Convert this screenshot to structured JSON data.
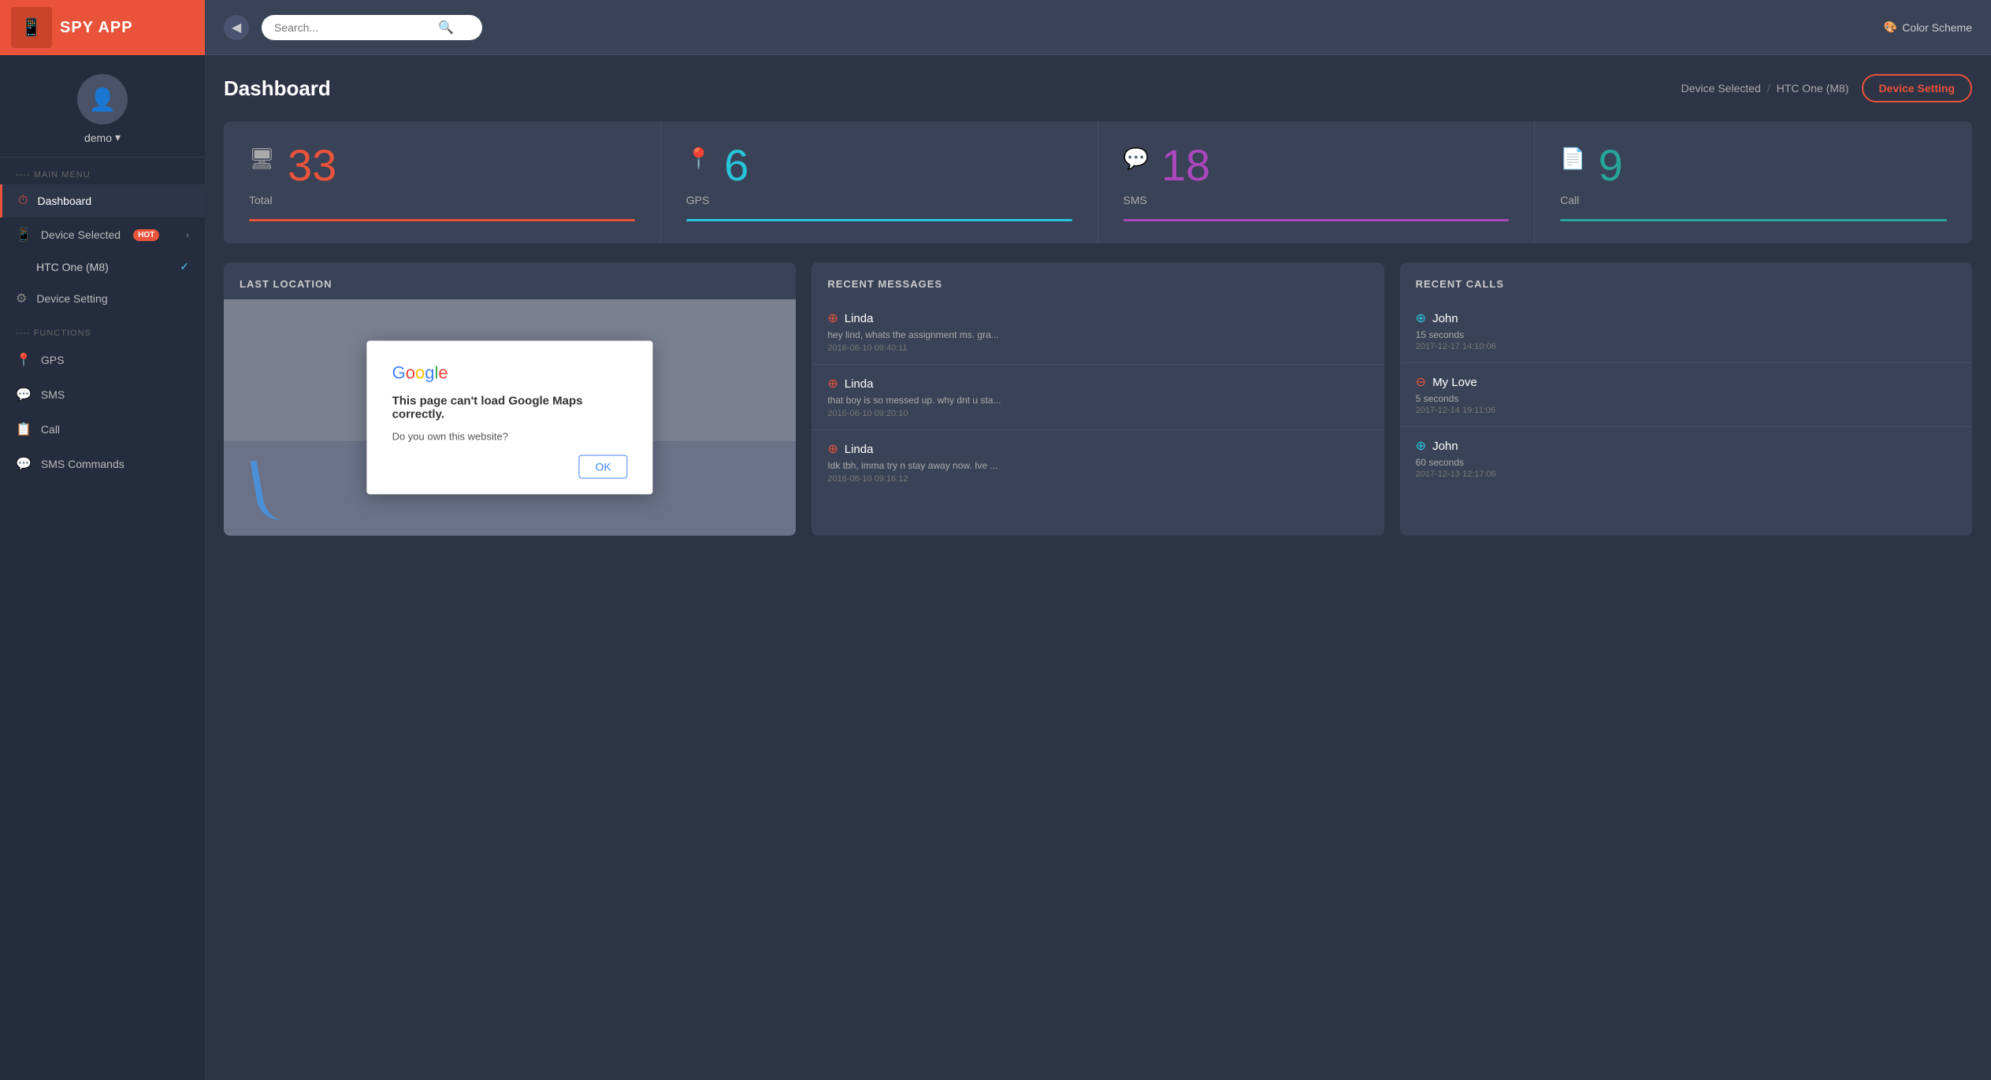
{
  "app": {
    "name": "SPY APP"
  },
  "sidebar": {
    "profile": {
      "username": "demo",
      "dropdown_indicator": "▾"
    },
    "main_menu_label": "---- MAIN MENU",
    "items": [
      {
        "id": "dashboard",
        "label": "Dashboard",
        "icon": "⏱",
        "active": true
      },
      {
        "id": "device-selected",
        "label": "Device Selected",
        "icon": "📱",
        "badge": "HOT",
        "chevron": "›",
        "active": false
      },
      {
        "id": "htc-one",
        "label": "HTC One (M8)",
        "sub": true,
        "check": "✓"
      },
      {
        "id": "device-setting",
        "label": "Device Setting",
        "icon": "⚙",
        "active": false
      }
    ],
    "functions_label": "---- FUNCTIONS",
    "function_items": [
      {
        "id": "gps",
        "label": "GPS",
        "icon": "📍"
      },
      {
        "id": "sms",
        "label": "SMS",
        "icon": "💬"
      },
      {
        "id": "call",
        "label": "Call",
        "icon": "📋"
      },
      {
        "id": "sms-commands",
        "label": "SMS Commands",
        "icon": "💬"
      }
    ]
  },
  "topbar": {
    "search_placeholder": "Search...",
    "color_scheme_label": "Color Scheme"
  },
  "header": {
    "title": "Dashboard",
    "breadcrumb_device_selected": "Device Selected",
    "breadcrumb_separator": "/",
    "breadcrumb_device": "HTC One (M8)",
    "device_setting_btn": "Device Setting"
  },
  "stats": [
    {
      "id": "total",
      "label": "Total",
      "value": "33",
      "color": "orange"
    },
    {
      "id": "gps",
      "label": "GPS",
      "value": "6",
      "color": "teal"
    },
    {
      "id": "sms",
      "label": "SMS",
      "value": "18",
      "color": "purple"
    },
    {
      "id": "call",
      "label": "Call",
      "value": "9",
      "color": "green"
    }
  ],
  "last_location": {
    "title": "LAST LOCATION",
    "dialog": {
      "logo": "Google",
      "title": "This page can't load Google Maps correctly.",
      "question": "Do you own this website?",
      "ok_btn": "OK"
    }
  },
  "recent_messages": {
    "title": "RECENT MESSAGES",
    "items": [
      {
        "name": "Linda",
        "direction": "incoming",
        "arrow": "➕",
        "text": "hey lind, whats the assignment ms. gra...",
        "time": "2016-06-10 09:40:11"
      },
      {
        "name": "Linda",
        "direction": "incoming",
        "arrow": "➕",
        "text": "that boy is so messed up. why dnt u sta...",
        "time": "2016-06-10 09:20:10"
      },
      {
        "name": "Linda",
        "direction": "incoming",
        "arrow": "➕",
        "text": "Idk tbh, imma try n stay away now. Ive ...",
        "time": "2016-06-10 09:16:12"
      }
    ]
  },
  "recent_calls": {
    "title": "RECENT CALLS",
    "items": [
      {
        "name": "John",
        "direction": "outgoing",
        "duration": "15 seconds",
        "time": "2017-12-17 14:10:06"
      },
      {
        "name": "My Love",
        "direction": "incoming",
        "duration": "5 seconds",
        "time": "2017-12-14 19:11:06"
      },
      {
        "name": "John",
        "direction": "outgoing",
        "duration": "60 seconds",
        "time": "2017-12-13 12:17:06"
      }
    ]
  }
}
